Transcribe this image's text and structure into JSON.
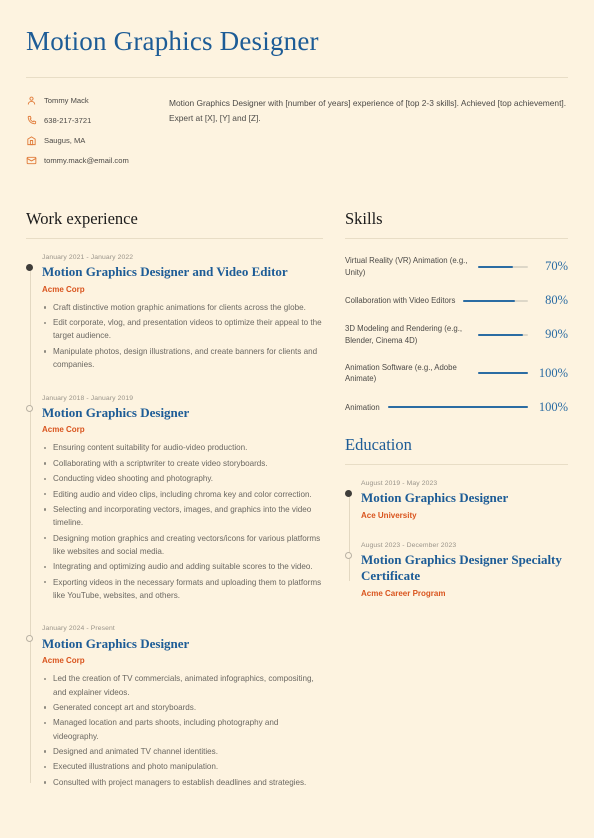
{
  "header": {
    "title": "Motion Graphics Designer",
    "contacts": [
      {
        "icon": "person-icon",
        "text": "Tommy Mack"
      },
      {
        "icon": "phone-icon",
        "text": "638-217-3721"
      },
      {
        "icon": "location-icon",
        "text": "Saugus, MA"
      },
      {
        "icon": "email-icon",
        "text": "tommy.mack@email.com"
      }
    ],
    "summary": "Motion Graphics Designer with [number of years] experience of [top 2-3 skills]. Achieved [top achievement]. Expert at [X], [Y] and [Z]."
  },
  "work_experience": {
    "section_title": "Work experience",
    "entries": [
      {
        "date": "January 2021 - January 2022",
        "role": "Motion Graphics Designer and Video Editor",
        "company": "Acme Corp",
        "marker": "filled",
        "bullets": [
          "Craft distinctive motion graphic animations for clients across the globe.",
          "Edit corporate, vlog, and presentation videos to optimize their appeal to the target audience.",
          "Manipulate photos, design illustrations, and create banners for clients and companies."
        ]
      },
      {
        "date": "January 2018 - January 2019",
        "role": "Motion Graphics Designer",
        "company": "Acme Corp",
        "marker": "hollow",
        "bullets": [
          "Ensuring content suitability for audio-video production.",
          "Collaborating with a scriptwriter to create video storyboards.",
          "Conducting video shooting and photography.",
          "Editing audio and video clips, including chroma key and color correction.",
          "Selecting and incorporating vectors, images, and graphics into the video timeline.",
          "Designing motion graphics and creating vectors/icons for various platforms like websites and social media.",
          "Integrating and optimizing audio and adding suitable scores to the video.",
          "Exporting videos in the necessary formats and uploading them to platforms like YouTube, websites, and others."
        ]
      },
      {
        "date": "January 2024 - Present",
        "role": "Motion Graphics Designer",
        "company": "Acme Corp",
        "marker": "hollow",
        "bullets": [
          "Led the creation of TV commercials, animated infographics, compositing, and explainer videos.",
          "Generated concept art and storyboards.",
          "Managed location and parts shoots, including photography and videography.",
          "Designed and animated TV channel identities.",
          "Executed illustrations and photo manipulation.",
          "Consulted with project managers to establish deadlines and strategies."
        ]
      }
    ]
  },
  "skills": {
    "section_title": "Skills",
    "items": [
      {
        "name": "Virtual Reality (VR) Animation (e.g., Unity)",
        "percent": 70,
        "percent_label": "70%"
      },
      {
        "name": "Collaboration with Video Editors",
        "percent": 80,
        "percent_label": "80%"
      },
      {
        "name": "3D Modeling and Rendering (e.g., Blender, Cinema 4D)",
        "percent": 90,
        "percent_label": "90%"
      },
      {
        "name": "Animation Software (e.g., Adobe Animate)",
        "percent": 100,
        "percent_label": "100%"
      },
      {
        "name": "Animation",
        "percent": 100,
        "percent_label": "100%"
      }
    ]
  },
  "education": {
    "section_title": "Education",
    "entries": [
      {
        "date": "August 2019 - May 2023",
        "degree": "Motion Graphics Designer",
        "institution": "Ace University",
        "marker": "filled"
      },
      {
        "date": "August 2023 - December 2023",
        "degree": "Motion Graphics Designer Specialty Certificate",
        "institution": "Acme Career Program",
        "marker": "hollow"
      }
    ]
  },
  "theme": {
    "background": "#fdf3e0",
    "title_blue": "#1d5c96",
    "accent_orange": "#d9541e",
    "icon_orange": "#e07b39",
    "rule": "#e8ddc6",
    "body_text": "#6b6862",
    "muted_text": "#9a948a"
  }
}
